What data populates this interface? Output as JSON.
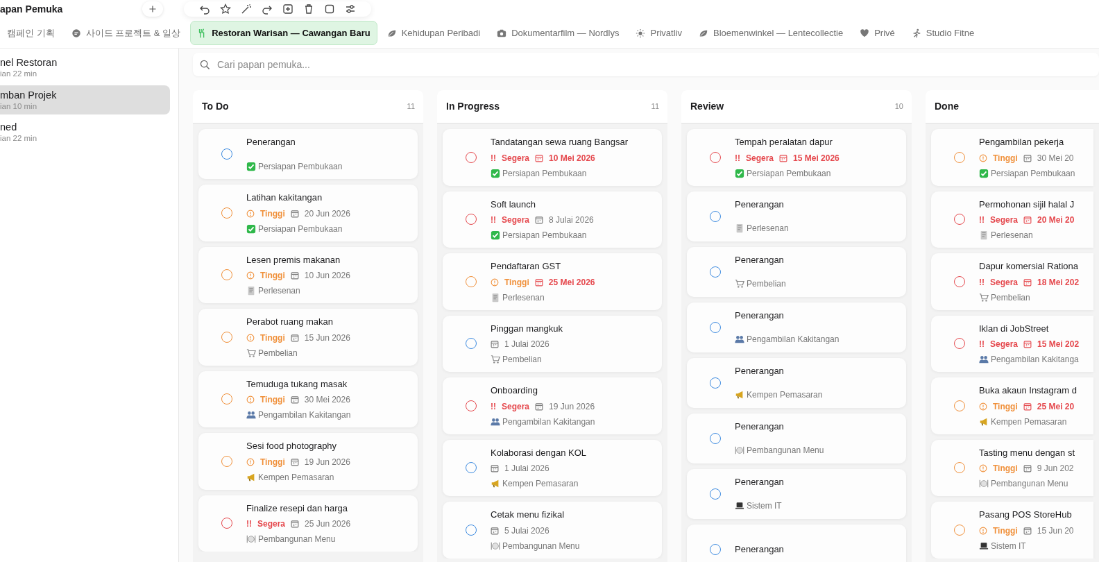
{
  "app": {
    "title": "apan Pemuka"
  },
  "tabs": [
    {
      "label": "캠페인 기획",
      "kind": "none",
      "selected": false
    },
    {
      "label": "사이드 프로젝트 & 일상",
      "kind": "chat",
      "selected": false
    },
    {
      "label": "Restoran Warisan — Cawangan Baru",
      "kind": "dining",
      "selected": true
    },
    {
      "label": "Kehidupan Peribadi",
      "kind": "leaf",
      "selected": false
    },
    {
      "label": "Dokumentarfilm — Nordlys",
      "kind": "camera",
      "selected": false
    },
    {
      "label": "Privatliv",
      "kind": "sun",
      "selected": false
    },
    {
      "label": "Bloemenwinkel — Lentecollectie",
      "kind": "leaf",
      "selected": false
    },
    {
      "label": "Privé",
      "kind": "heart",
      "selected": false
    },
    {
      "label": "Studio Fitne",
      "kind": "runner",
      "selected": false
    }
  ],
  "sidebar": {
    "items": [
      {
        "title": "nel Restoran",
        "subtitle": "ian 22 min",
        "selected": false
      },
      {
        "title": "mban Projek",
        "subtitle": "ian 10 min",
        "selected": true
      },
      {
        "title": "ned",
        "subtitle": "ian 22 min",
        "selected": false
      }
    ]
  },
  "search": {
    "placeholder": "Cari papan pemuka..."
  },
  "columns": [
    {
      "title": "To Do",
      "count": "11",
      "cards": [
        {
          "title": "Penerangan",
          "category": {
            "kind": "setup",
            "label": "Persiapan Pembukaan"
          }
        },
        {
          "title": "Latihan kakitangan",
          "priority": {
            "kind": "high",
            "label": "Tinggi"
          },
          "due": {
            "date": "20 Jun 2026",
            "overdue": false
          },
          "category": {
            "kind": "setup",
            "label": "Persiapan Pembukaan"
          }
        },
        {
          "title": "Lesen premis makanan",
          "priority": {
            "kind": "high",
            "label": "Tinggi"
          },
          "due": {
            "date": "10 Jun 2026",
            "overdue": false
          },
          "category": {
            "kind": "licensing",
            "label": "Perlesenan"
          }
        },
        {
          "title": "Perabot ruang makan",
          "priority": {
            "kind": "high",
            "label": "Tinggi"
          },
          "due": {
            "date": "15 Jun 2026",
            "overdue": false
          },
          "category": {
            "kind": "purchasing",
            "label": "Pembelian"
          }
        },
        {
          "title": "Temuduga tukang masak",
          "priority": {
            "kind": "high",
            "label": "Tinggi"
          },
          "due": {
            "date": "30 Mei 2026",
            "overdue": false
          },
          "category": {
            "kind": "hiring",
            "label": "Pengambilan Kakitangan"
          }
        },
        {
          "title": "Sesi food photography",
          "priority": {
            "kind": "high",
            "label": "Tinggi"
          },
          "due": {
            "date": "19 Jun 2026",
            "overdue": false
          },
          "category": {
            "kind": "marketing",
            "label": "Kempen Pemasaran"
          }
        },
        {
          "title": "Finalize resepi dan harga",
          "priority": {
            "kind": "urgent",
            "mark": "!!",
            "label": "Segera"
          },
          "due": {
            "date": "25 Jun 2026",
            "overdue": false
          },
          "category": {
            "kind": "menu",
            "label": "Pembangunan Menu"
          }
        }
      ]
    },
    {
      "title": "In Progress",
      "count": "11",
      "cards": [
        {
          "title": "Tandatangan sewa ruang Bangsar",
          "priority": {
            "kind": "urgent",
            "mark": "!!",
            "label": "Segera"
          },
          "due": {
            "date": "10 Mei 2026",
            "overdue": true
          },
          "category": {
            "kind": "setup",
            "label": "Persiapan Pembukaan"
          }
        },
        {
          "title": "Soft launch",
          "priority": {
            "kind": "urgent",
            "mark": "!!",
            "label": "Segera"
          },
          "due": {
            "date": "8 Julai 2026",
            "overdue": false
          },
          "category": {
            "kind": "setup",
            "label": "Persiapan Pembukaan"
          }
        },
        {
          "title": "Pendaftaran GST",
          "priority": {
            "kind": "high",
            "label": "Tinggi"
          },
          "due": {
            "date": "25 Mei 2026",
            "overdue": true
          },
          "category": {
            "kind": "licensing",
            "label": "Perlesenan"
          }
        },
        {
          "title": "Pinggan mangkuk",
          "due": {
            "date": "1 Julai 2026",
            "overdue": false
          },
          "category": {
            "kind": "purchasing",
            "label": "Pembelian"
          }
        },
        {
          "title": "Onboarding",
          "priority": {
            "kind": "urgent",
            "mark": "!!",
            "label": "Segera"
          },
          "due": {
            "date": "19 Jun 2026",
            "overdue": false
          },
          "category": {
            "kind": "hiring",
            "label": "Pengambilan Kakitangan"
          }
        },
        {
          "title": "Kolaborasi dengan KOL",
          "due": {
            "date": "1 Julai 2026",
            "overdue": false
          },
          "category": {
            "kind": "marketing",
            "label": "Kempen Pemasaran"
          }
        },
        {
          "title": "Cetak menu fizikal",
          "due": {
            "date": "5 Julai 2026",
            "overdue": false
          },
          "category": {
            "kind": "menu",
            "label": "Pembangunan Menu"
          }
        }
      ]
    },
    {
      "title": "Review",
      "count": "10",
      "cards": [
        {
          "title": "Tempah peralatan dapur",
          "priority": {
            "kind": "urgent",
            "mark": "!!",
            "label": "Segera"
          },
          "due": {
            "date": "15 Mei 2026",
            "overdue": true
          },
          "category": {
            "kind": "setup",
            "label": "Persiapan Pembukaan"
          }
        },
        {
          "title": "Penerangan",
          "category": {
            "kind": "licensing",
            "label": "Perlesenan"
          }
        },
        {
          "title": "Penerangan",
          "category": {
            "kind": "purchasing",
            "label": "Pembelian"
          }
        },
        {
          "title": "Penerangan",
          "category": {
            "kind": "hiring",
            "label": "Pengambilan Kakitangan"
          }
        },
        {
          "title": "Penerangan",
          "category": {
            "kind": "marketing",
            "label": "Kempen Pemasaran"
          }
        },
        {
          "title": "Penerangan",
          "category": {
            "kind": "menu",
            "label": "Pembangunan Menu"
          }
        },
        {
          "title": "Penerangan",
          "category": {
            "kind": "it",
            "label": "Sistem IT"
          }
        },
        {
          "title": "Penerangan"
        }
      ]
    },
    {
      "title": "Done",
      "cards": [
        {
          "title": "Pengambilan pekerja",
          "priority": {
            "kind": "high",
            "label": "Tinggi"
          },
          "due": {
            "date": "30 Mei 20",
            "overdue": false
          },
          "category": {
            "kind": "setup",
            "label": "Persiapan Pembukaan"
          }
        },
        {
          "title": "Permohonan sijil halal J",
          "priority": {
            "kind": "urgent",
            "mark": "!!",
            "label": "Segera"
          },
          "due": {
            "date": "20 Mei 20",
            "overdue": true
          },
          "category": {
            "kind": "licensing",
            "label": "Perlesenan"
          }
        },
        {
          "title": "Dapur komersial Rationa",
          "priority": {
            "kind": "urgent",
            "mark": "!!",
            "label": "Segera"
          },
          "due": {
            "date": "18 Mei 202",
            "overdue": true
          },
          "category": {
            "kind": "purchasing",
            "label": "Pembelian"
          }
        },
        {
          "title": "Iklan di JobStreet",
          "priority": {
            "kind": "urgent",
            "mark": "!!",
            "label": "Segera"
          },
          "due": {
            "date": "15 Mei 202",
            "overdue": true
          },
          "category": {
            "kind": "hiring",
            "label": "Pengambilan Kakitanga"
          }
        },
        {
          "title": "Buka akaun Instagram d",
          "priority": {
            "kind": "high",
            "label": "Tinggi"
          },
          "due": {
            "date": "25 Mei 20",
            "overdue": true
          },
          "category": {
            "kind": "marketing",
            "label": "Kempen Pemasaran"
          }
        },
        {
          "title": "Tasting menu dengan st",
          "priority": {
            "kind": "high",
            "label": "Tinggi"
          },
          "due": {
            "date": "9 Jun 202",
            "overdue": false
          },
          "category": {
            "kind": "menu",
            "label": "Pembangunan Menu"
          }
        },
        {
          "title": "Pasang POS StoreHub",
          "priority": {
            "kind": "high",
            "label": "Tinggi"
          },
          "due": {
            "date": "15 Jun 20",
            "overdue": false
          },
          "category": {
            "kind": "it",
            "label": "Sistem IT"
          }
        }
      ]
    }
  ]
}
